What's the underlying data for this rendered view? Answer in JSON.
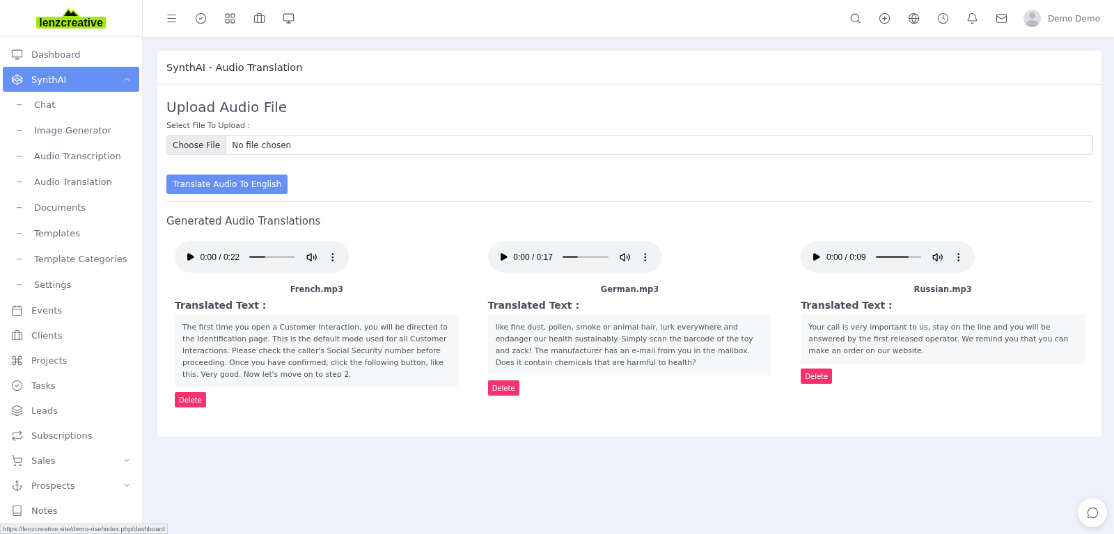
{
  "logo": {
    "text": "lenzcreative"
  },
  "sidebar": {
    "items": [
      {
        "label": "Dashboard",
        "kind": "link",
        "selected": false
      },
      {
        "label": "SynthAI",
        "kind": "group",
        "selected": true,
        "expanded": true,
        "children": [
          {
            "label": "Chat",
            "selected": false
          },
          {
            "label": "Image Generator",
            "selected": false
          },
          {
            "label": "Audio Transcription",
            "selected": false
          },
          {
            "label": "Audio Translation",
            "selected": false
          },
          {
            "label": "Documents",
            "selected": false
          },
          {
            "label": "Templates",
            "selected": false
          },
          {
            "label": "Template Categories",
            "selected": false
          },
          {
            "label": "Settings",
            "selected": false
          }
        ]
      },
      {
        "label": "Events",
        "kind": "link",
        "selected": false
      },
      {
        "label": "Clients",
        "kind": "link",
        "selected": false
      },
      {
        "label": "Projects",
        "kind": "link",
        "selected": false
      },
      {
        "label": "Tasks",
        "kind": "link",
        "selected": false
      },
      {
        "label": "Leads",
        "kind": "link",
        "selected": false
      },
      {
        "label": "Subscriptions",
        "kind": "link",
        "selected": false
      },
      {
        "label": "Sales",
        "kind": "group",
        "selected": false,
        "expanded": false
      },
      {
        "label": "Prospects",
        "kind": "group",
        "selected": false,
        "expanded": false
      },
      {
        "label": "Notes",
        "kind": "link",
        "selected": false
      }
    ]
  },
  "header": {
    "user": "Demo Demo"
  },
  "card": {
    "title": "SynthAI - Audio Translation",
    "upload": {
      "heading": "Upload Audio File",
      "label": "Select File To Upload :",
      "button": "Choose File",
      "value": "No file chosen"
    },
    "submit": "Translate Audio To English",
    "section": "Generated Audio Translations",
    "translations": [
      {
        "time": "0:00 / 0:22",
        "level": 0.35,
        "file": "French.mp3",
        "label": "Translated Text :",
        "text": "The first time you open a Customer Interaction, you will be directed to the Identification page. This is the default mode used for all Customer Interactions. Please check the caller's Social Security number before proceeding. Once you have confirmed, click the following button, like this. Very good. Now let's move on to step 2.",
        "delete": "Delete"
      },
      {
        "time": "0:00 / 0:17",
        "level": 0.33,
        "file": "German.mp3",
        "label": "Translated Text :",
        "text": "like fine dust, pollen, smoke or animal hair, lurk everywhere and endanger our health sustainably. Simply scan the barcode of the toy and zack! The manufacturer has an e-mail from you in the mailbox. Does it contain chemicals that are harmful to health?",
        "delete": "Delete"
      },
      {
        "time": "0:00 / 0:09",
        "level": 0.72,
        "file": "Russian.mp3",
        "label": "Translated Text :",
        "text": "Your call is very important to us, stay on the line and you will be answered by the first released operator. We remind you that you can make an order on our website.",
        "delete": "Delete"
      }
    ]
  },
  "status_url": "https://lenzcreative.site/demo-rise/index.php/dashboard"
}
